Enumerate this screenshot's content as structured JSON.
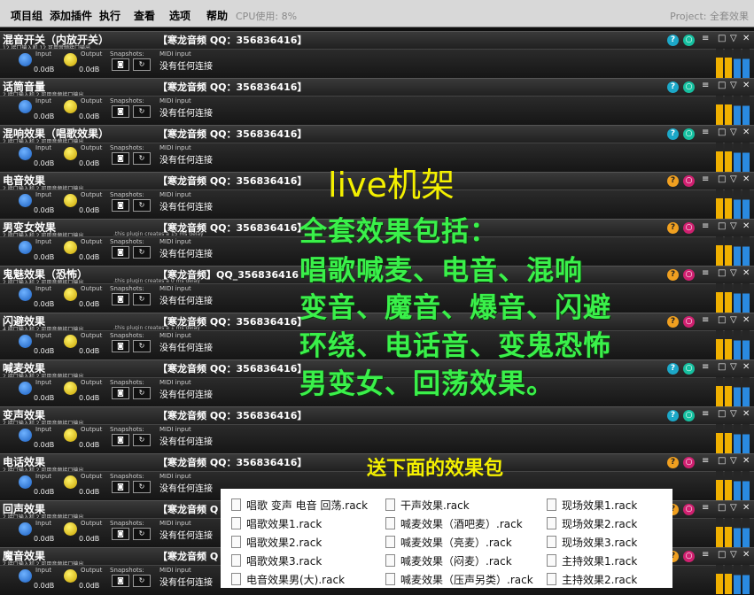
{
  "menu": [
    "项目组",
    "添加插件",
    "执行",
    "查看",
    "选项",
    "帮助"
  ],
  "cpu": "CPU使用: 8%",
  "project": "Project: 全套效果",
  "common": {
    "input_label": "Input",
    "output_label": "Output",
    "db": "0.0dB",
    "snapshots_label": "Snapshots:",
    "midi_label": "MIDI input",
    "midi_status": "没有任何连接"
  },
  "racks": [
    {
      "name": "混音开关（内放开关）",
      "sub": "12 接口输入和 12 可用音频接口输出",
      "title": "【寒龙音频 QQ：356836416】",
      "note": ""
    },
    {
      "name": "话筒音量",
      "sub": "2 接口输入和 2 可用音频接口输出",
      "title": "【寒龙音频 QQ：356836416】",
      "note": ""
    },
    {
      "name": "混响效果（唱歌效果）",
      "sub": "2 接口输入和 2 可用音频接口输出",
      "title": "【寒龙音频 QQ：356836416】",
      "note": ""
    },
    {
      "name": "电音效果",
      "sub": "2 接口输入和 2 可用音频接口输出",
      "title": "【寒龙音频 QQ：356836416】",
      "note": ""
    },
    {
      "name": "男变女效果",
      "sub": "2 接口输入和 2 可用音频接口输出",
      "title": "【寒龙音频 QQ：356836416】",
      "note": ".this plugin creates a 15 ms delay"
    },
    {
      "name": "鬼魅效果（恐怖）",
      "sub": "2 接口输入和 2 可用音频接口输出",
      "title": "【寒龙音频】QQ_356836416",
      "note": ".this plugin creates a 0 ms delay"
    },
    {
      "name": "闪避效果",
      "sub": "4 接口输入和 2 可用音频接口输出",
      "title": "【寒龙音频 QQ：356836416】",
      "note": ".this plugin creates a 1 ms delay"
    },
    {
      "name": "喊麦效果",
      "sub": "2 接口输入和 2 可用音频接口输出",
      "title": "【寒龙音频 QQ：356836416】",
      "note": ""
    },
    {
      "name": "变声效果",
      "sub": "2 接口输入和 2 可用音频接口输出",
      "title": "【寒龙音频 QQ：356836416】",
      "note": ""
    },
    {
      "name": "电话效果",
      "sub": "2 接口输入和 2 可用音频接口输出",
      "title": "【寒龙音频 QQ：356836416】",
      "note": ""
    },
    {
      "name": "回声效果",
      "sub": "2 接口输入和 2 可用音频接口输出",
      "title": "【寒龙音频 Q",
      "note": ""
    },
    {
      "name": "魔音效果",
      "sub": "2 接口输入和 2 可用音频接口输出",
      "title": "【寒龙音频 Q",
      "note": ""
    }
  ],
  "promo": {
    "live": "live机架",
    "lines": [
      "全套效果包括：",
      "唱歌喊麦、电音、混响",
      "变音、魔音、爆音、闪避",
      "环绕、电话音、变鬼恐怖",
      "男变女、回荡效果。"
    ],
    "send": "送下面的效果包"
  },
  "files": [
    [
      "唱歌 变声 电音 回荡.rack",
      "唱歌效果1.rack",
      "唱歌效果2.rack",
      "唱歌效果3.rack",
      "电音效果男(大).rack"
    ],
    [
      "干声效果.rack",
      "喊麦效果（酒吧麦）.rack",
      "喊麦效果（亮麦）.rack",
      "喊麦效果（闷麦）.rack",
      "喊麦效果（压声另类）.rack"
    ],
    [
      "现场效果1.rack",
      "现场效果2.rack",
      "现场效果3.rack",
      "主持效果1.rack",
      "主持效果2.rack"
    ]
  ]
}
